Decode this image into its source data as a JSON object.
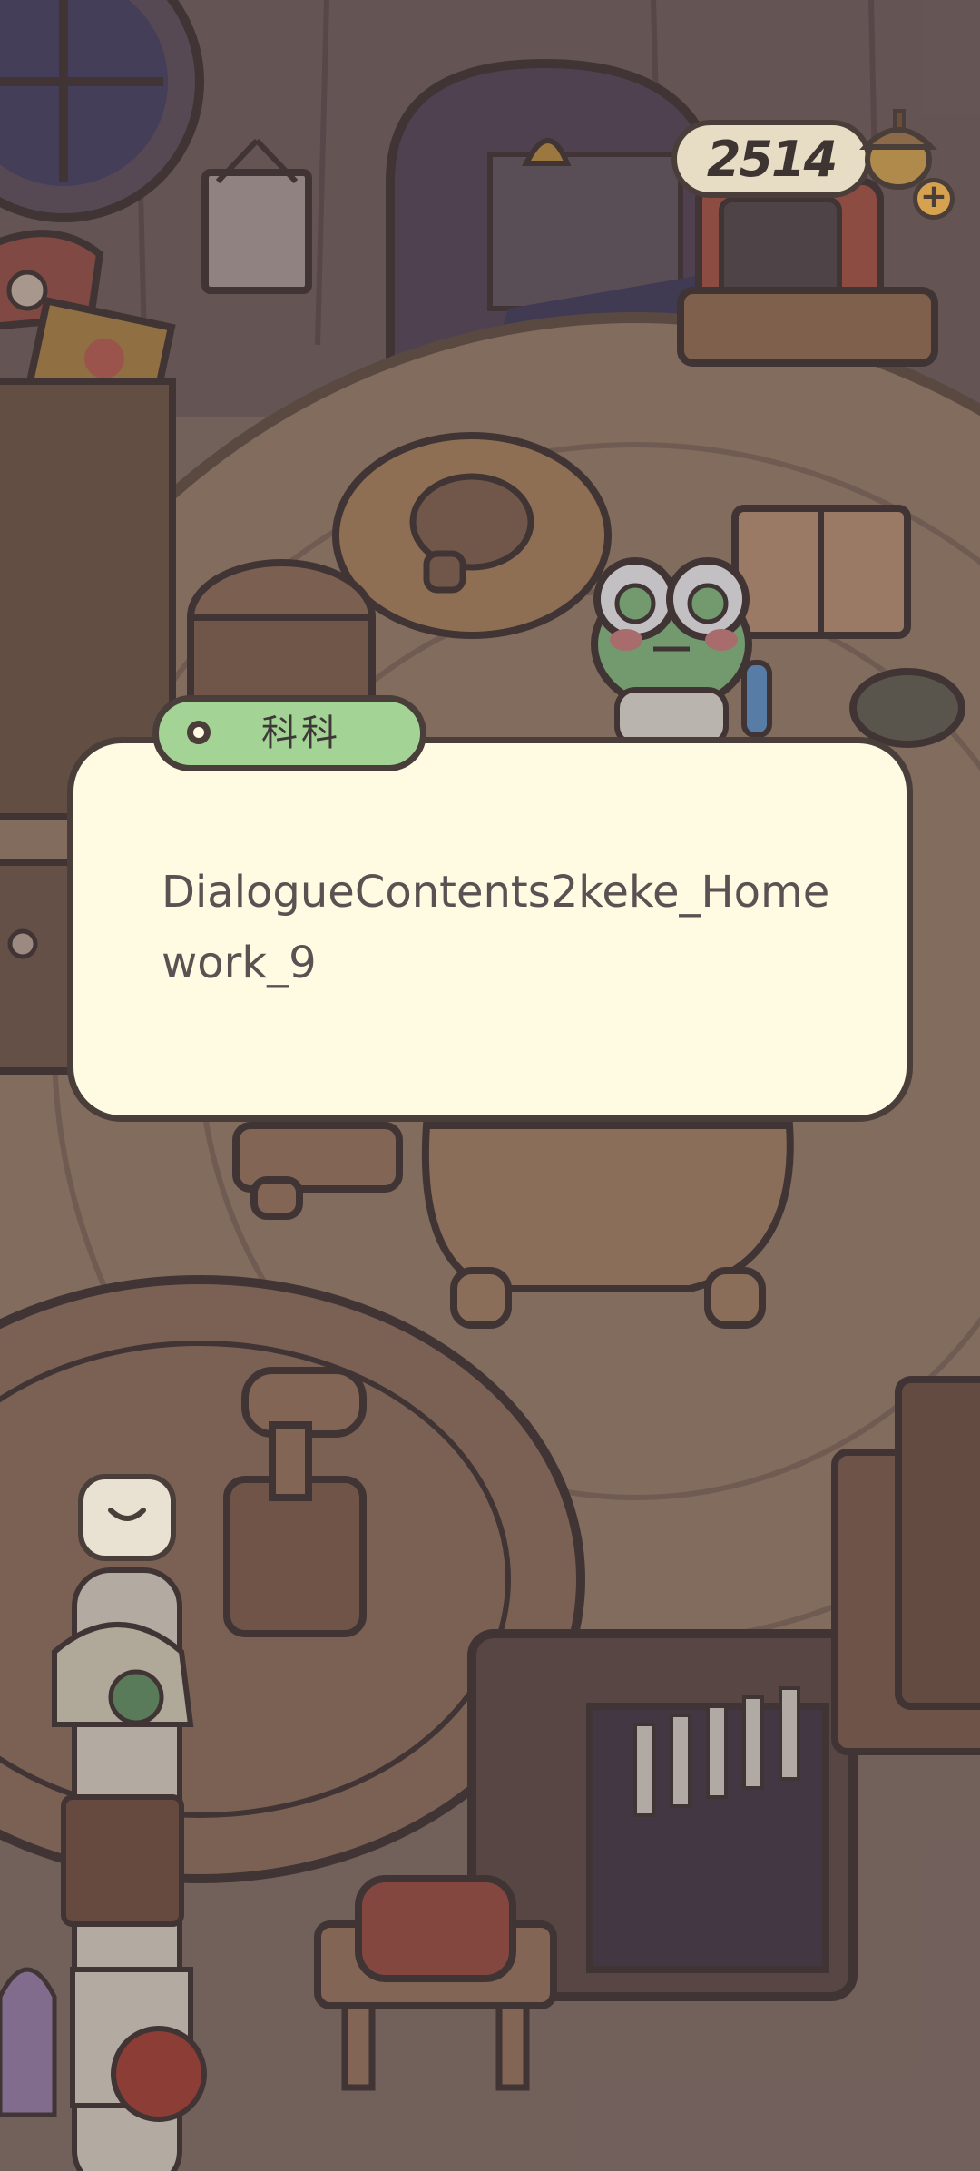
{
  "hud": {
    "currency_value": "2514",
    "currency_add_label": "+",
    "currency_icon": "acorn-icon"
  },
  "dialogue": {
    "speaker_name": "科科",
    "text": "DialogueContents2keke_Homework_9"
  },
  "sidebar": {
    "button_icon": "chevron-down-icon"
  },
  "colors": {
    "dialog_bg": "#fefbe2",
    "name_tag_bg": "#a4d495",
    "outline": "#4a3e3a",
    "frog_green": "#8fcb8a"
  }
}
